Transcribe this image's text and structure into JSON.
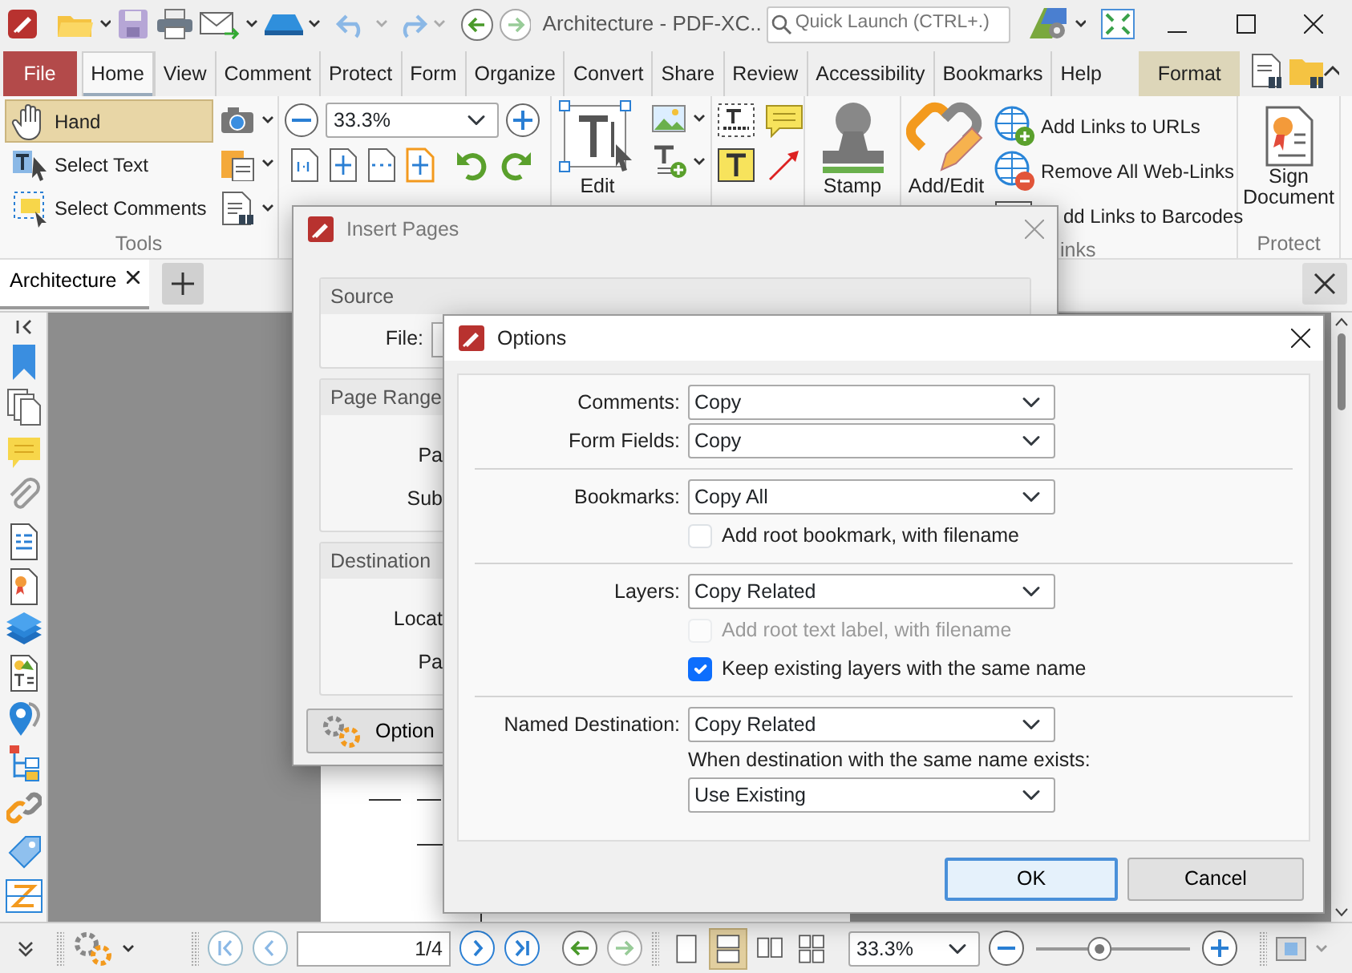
{
  "window": {
    "title": "Architecture - PDF-XC..",
    "search": {
      "placeholder": "Quick Launch (CTRL+.)"
    }
  },
  "ribbon_tabs": [
    {
      "label": "File",
      "kind": "file",
      "selected": false
    },
    {
      "label": "Home",
      "kind": "tab",
      "selected": true
    },
    {
      "label": "View",
      "kind": "tab",
      "selected": false
    },
    {
      "label": "Comment",
      "kind": "tab",
      "selected": false
    },
    {
      "label": "Protect",
      "kind": "tab",
      "selected": false
    },
    {
      "label": "Form",
      "kind": "tab",
      "selected": false
    },
    {
      "label": "Organize",
      "kind": "tab",
      "selected": false
    },
    {
      "label": "Convert",
      "kind": "tab",
      "selected": false
    },
    {
      "label": "Share",
      "kind": "tab",
      "selected": false
    },
    {
      "label": "Review",
      "kind": "tab",
      "selected": false
    },
    {
      "label": "Accessibility",
      "kind": "tab",
      "selected": false
    },
    {
      "label": "Bookmarks",
      "kind": "tab",
      "selected": false
    },
    {
      "label": "Help",
      "kind": "tab",
      "selected": false
    },
    {
      "label": "Format",
      "kind": "context",
      "selected": false
    }
  ],
  "ribbon": {
    "tools": [
      {
        "label": "Hand",
        "selected": true
      },
      {
        "label": "Select Text",
        "selected": false
      },
      {
        "label": "Select Comments",
        "selected": false
      }
    ],
    "tools_group": "Tools",
    "zoom": "33.3%",
    "edit_label": "Edit",
    "stamp_label": "Stamp",
    "add_edit_label": "Add/Edit",
    "links": [
      "Add Links to URLs",
      "Remove All Web-Links",
      "dd Links to Barcodes"
    ],
    "links_group": "inks",
    "sign_label": "Sign Document",
    "protect_group": "Protect"
  },
  "document_tabs": [
    {
      "label": "Architecture",
      "selected": true
    }
  ],
  "insert_pages": {
    "title": "Insert Pages",
    "sections": [
      {
        "title": "Source",
        "labels": [
          "File:"
        ]
      },
      {
        "title": "Page Range",
        "labels": [
          "Pa",
          "Sub"
        ]
      },
      {
        "title": "Destination",
        "labels": [
          "Locat",
          "Pa"
        ]
      }
    ],
    "options_button": "Option"
  },
  "options": {
    "title": "Options",
    "groups": [
      [
        {
          "kind": "select",
          "label": "Comments:",
          "value": "Copy"
        },
        {
          "kind": "select",
          "label": "Form Fields:",
          "value": "Copy"
        }
      ],
      [
        {
          "kind": "select",
          "label": "Bookmarks:",
          "value": "Copy All"
        },
        {
          "kind": "checkbox",
          "label": "Add root bookmark, with filename",
          "checked": false,
          "disabled": false
        }
      ],
      [
        {
          "kind": "select",
          "label": "Layers:",
          "value": "Copy Related"
        },
        {
          "kind": "checkbox",
          "label": "Add root text label, with filename",
          "checked": false,
          "disabled": true
        },
        {
          "kind": "checkbox",
          "label": "Keep existing layers with the same name",
          "checked": true,
          "disabled": false
        }
      ],
      [
        {
          "kind": "select",
          "label": "Named Destination:",
          "value": "Copy Related"
        },
        {
          "kind": "note",
          "label": "When destination with the same name exists:"
        },
        {
          "kind": "select",
          "value": "Use Existing"
        }
      ]
    ],
    "buttons": [
      {
        "label": "OK",
        "default": true
      },
      {
        "label": "Cancel",
        "default": false
      }
    ]
  },
  "status_bar": {
    "page": "1/4",
    "zoom": "33.3%",
    "zoom_slider": {
      "level": 0.4
    },
    "view_modes": [
      {
        "selected": false
      },
      {
        "selected": true
      },
      {
        "selected": false
      },
      {
        "selected": false
      }
    ]
  }
}
